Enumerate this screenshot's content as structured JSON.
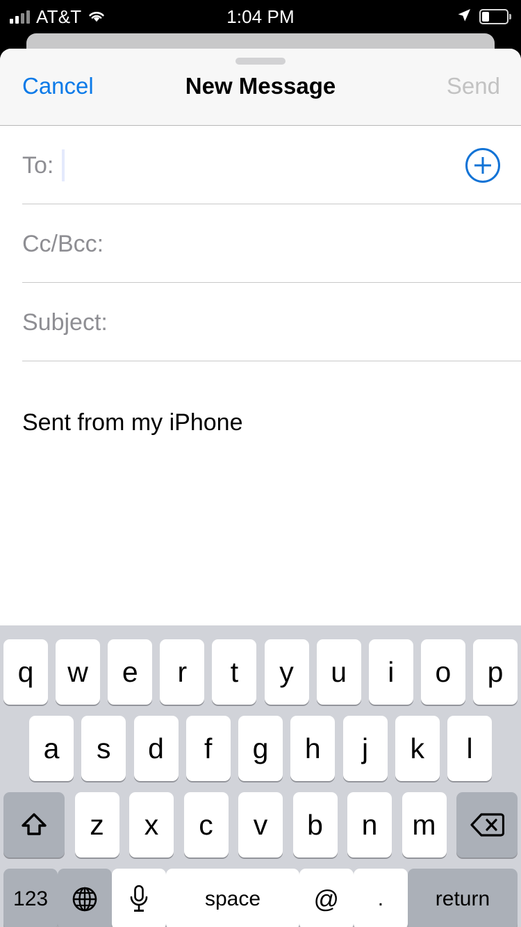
{
  "status_bar": {
    "carrier": "AT&T",
    "time": "1:04 PM",
    "signal_bars_filled": 2,
    "signal_bars_total": 4,
    "wifi_icon": "wifi-icon",
    "location_icon": "location-arrow-icon",
    "battery_percent": 30,
    "battery_icon": "battery-icon"
  },
  "navbar": {
    "cancel_label": "Cancel",
    "title": "New Message",
    "send_label": "Send",
    "send_enabled": false,
    "grabber": "sheet-grabber"
  },
  "compose": {
    "fields": [
      {
        "label": "To:",
        "value": "",
        "has_caret": true,
        "has_add_button": true,
        "add_icon": "plus-circle-icon"
      },
      {
        "label": "Cc/Bcc:",
        "value": "",
        "has_caret": false,
        "has_add_button": false
      },
      {
        "label": "Subject:",
        "value": "",
        "has_caret": false,
        "has_add_button": false
      }
    ],
    "body_text": "Sent from my iPhone"
  },
  "keyboard": {
    "row1": [
      "q",
      "w",
      "e",
      "r",
      "t",
      "y",
      "u",
      "i",
      "o",
      "p"
    ],
    "row2": [
      "a",
      "s",
      "d",
      "f",
      "g",
      "h",
      "j",
      "k",
      "l"
    ],
    "row3_letters": [
      "z",
      "x",
      "c",
      "v",
      "b",
      "n",
      "m"
    ],
    "shift_icon": "shift-icon",
    "backspace_icon": "backspace-icon",
    "numbers_label": "123",
    "globe_icon": "globe-icon",
    "mic_icon": "microphone-icon",
    "space_label": "space",
    "at_label": "@",
    "period_label": ".",
    "return_label": "return"
  },
  "colors": {
    "accent_blue": "#0b7ae8",
    "nav_background": "#f7f7f7",
    "keyboard_background": "#d1d3d9",
    "key_white": "#ffffff",
    "key_dark": "#abb0b8",
    "placeholder_gray": "#8e8e93",
    "disabled_gray": "#c2c2c2"
  }
}
